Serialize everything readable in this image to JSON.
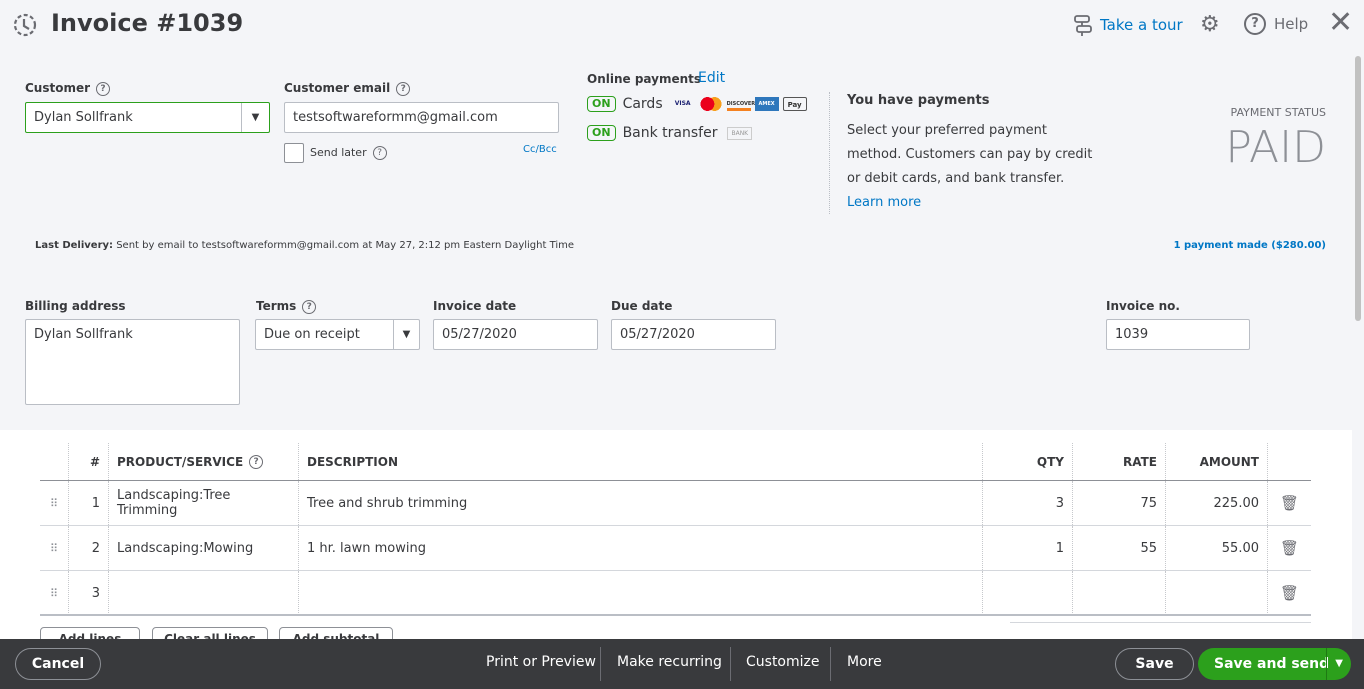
{
  "header": {
    "title": "Invoice #1039",
    "tour": "Take a tour",
    "help": "Help"
  },
  "customer": {
    "label": "Customer",
    "value": "Dylan Sollfrank"
  },
  "email": {
    "label": "Customer email",
    "value": "testsoftwareformm@gmail.com",
    "send_later": "Send later",
    "ccbcc": "Cc/Bcc"
  },
  "online": {
    "label": "Online payments",
    "edit": "Edit",
    "on": "ON",
    "cards": "Cards",
    "bank": "Bank transfer",
    "card_icons": [
      "VISA",
      "MC",
      "DISCOVER",
      "AMEX",
      "Pay"
    ],
    "bank_icon": "BANK"
  },
  "payments_info": {
    "title": "You have payments",
    "body": "Select your preferred payment method. Customers can pay by credit or debit cards, and bank transfer.",
    "learn": "Learn more"
  },
  "status": {
    "label": "PAYMENT STATUS",
    "value": "PAID"
  },
  "delivery": {
    "label": "Last Delivery:",
    "text": " Sent by email to testsoftwareformm@gmail.com at May 27, 2:12 pm Eastern Daylight Time",
    "payment_link": "1 payment made ($280.00)"
  },
  "billing": {
    "label": "Billing address",
    "value": "Dylan Sollfrank"
  },
  "terms": {
    "label": "Terms",
    "value": "Due on receipt"
  },
  "invoice_date": {
    "label": "Invoice date",
    "value": "05/27/2020"
  },
  "due_date": {
    "label": "Due date",
    "value": "05/27/2020"
  },
  "invoice_no": {
    "label": "Invoice no.",
    "value": "1039"
  },
  "table": {
    "headers": [
      "#",
      "PRODUCT/SERVICE",
      "DESCRIPTION",
      "QTY",
      "RATE",
      "AMOUNT"
    ],
    "rows": [
      {
        "n": "1",
        "product": "Landscaping:Tree Trimming",
        "desc": "Tree and shrub trimming",
        "qty": "3",
        "rate": "75",
        "amount": "225.00"
      },
      {
        "n": "2",
        "product": "Landscaping:Mowing",
        "desc": "1 hr. lawn mowing",
        "qty": "1",
        "rate": "55",
        "amount": "55.00"
      },
      {
        "n": "3",
        "product": "",
        "desc": "",
        "qty": "",
        "rate": "",
        "amount": ""
      }
    ]
  },
  "line_buttons": {
    "add": "Add lines",
    "clear": "Clear all lines",
    "subtotal": "Add subtotal"
  },
  "footer": {
    "cancel": "Cancel",
    "print": "Print or Preview",
    "recurring": "Make recurring",
    "customize": "Customize",
    "more": "More",
    "save": "Save",
    "save_send": "Save and send"
  },
  "colors": {
    "green": "#2ca01c",
    "blue": "#0077c5",
    "footer": "#393a3d"
  }
}
